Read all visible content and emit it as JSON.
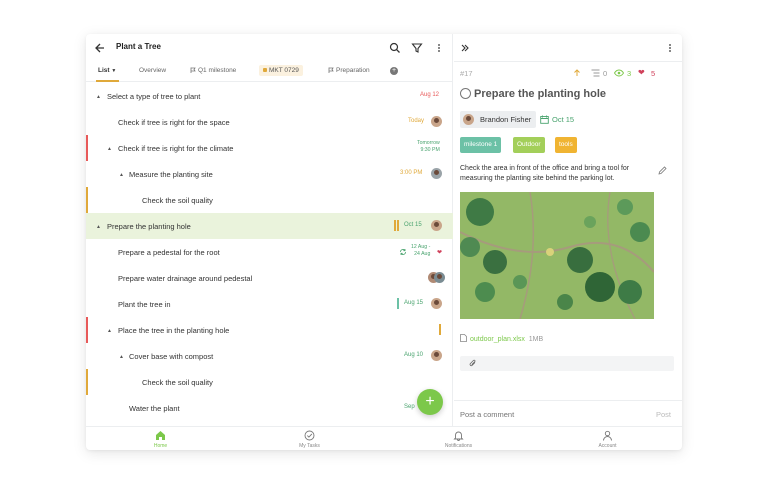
{
  "header": {
    "title": "Plant a Tree"
  },
  "tabs": [
    {
      "label": "List"
    },
    {
      "label": "Overview"
    },
    {
      "label": "Q1 milestone"
    },
    {
      "label": "MKT 0729"
    },
    {
      "label": "Preparation"
    }
  ],
  "tasks": [
    {
      "label": "Select a type of tree to plant",
      "date": "Aug 12",
      "date_color": "#e85a5a"
    },
    {
      "label": "Check if tree is right for the space",
      "date": "Today",
      "date_color": "#e0a93a"
    },
    {
      "label": "Check if tree is right for the climate",
      "date": "Tomorrow",
      "date_b": "9:30 PM",
      "date_color": "#49a36e"
    },
    {
      "label": "Measure the planting site",
      "date": "3:00 PM",
      "date_color": "#e0a93a"
    },
    {
      "label": "Check the soil quality"
    },
    {
      "label": "Prepare the planting hole",
      "date": "Oct 15",
      "date_color": "#49a36e"
    },
    {
      "label": "Prepare a pedestal for the root",
      "date": "12 Aug -",
      "date_b": "24 Aug",
      "date_color": "#49a36e"
    },
    {
      "label": "Prepare water drainage around pedestal"
    },
    {
      "label": "Plant the tree in",
      "date": "Aug 15",
      "date_color": "#49a36e"
    },
    {
      "label": "Place the tree in the planting hole"
    },
    {
      "label": "Cover base with compost",
      "date": "Aug 10",
      "date_color": "#49a36e"
    },
    {
      "label": "Check the soil quality"
    },
    {
      "label": "Water the plant",
      "date": "Sep",
      "date_color": "#49a36e"
    }
  ],
  "detail": {
    "id": "#17",
    "subtasks_count": "0",
    "watchers_count": "3",
    "likes_count": "5",
    "title": "Prepare the planting hole",
    "assignee": "Brandon Fisher",
    "due_date": "Oct 15",
    "tags": [
      {
        "label": "milestone 1",
        "color": "#6cc1a6"
      },
      {
        "label": "Outdoor",
        "color": "#a3cf5a"
      },
      {
        "label": "tools",
        "color": "#f0b432"
      }
    ],
    "description": "Check the area in front of the office and bring a tool for measuring the planting site behind the parking lot.",
    "attachment_name": "outdoor_plan.xlsx",
    "attachment_size": "1MB",
    "comment_placeholder": "Post a comment",
    "post_label": "Post"
  },
  "bottom_nav": [
    {
      "label": "Home",
      "icon": "home-icon"
    },
    {
      "label": "My Tasks",
      "icon": "check-circle-icon"
    },
    {
      "label": "Notifications",
      "icon": "bell-icon"
    },
    {
      "label": "Account",
      "icon": "person-icon"
    }
  ],
  "colors": {
    "accent_green": "#7cc84a",
    "highlight_row": "#eaf3dc",
    "overdue_red": "#e85a5a",
    "today_orange": "#e0a93a"
  }
}
